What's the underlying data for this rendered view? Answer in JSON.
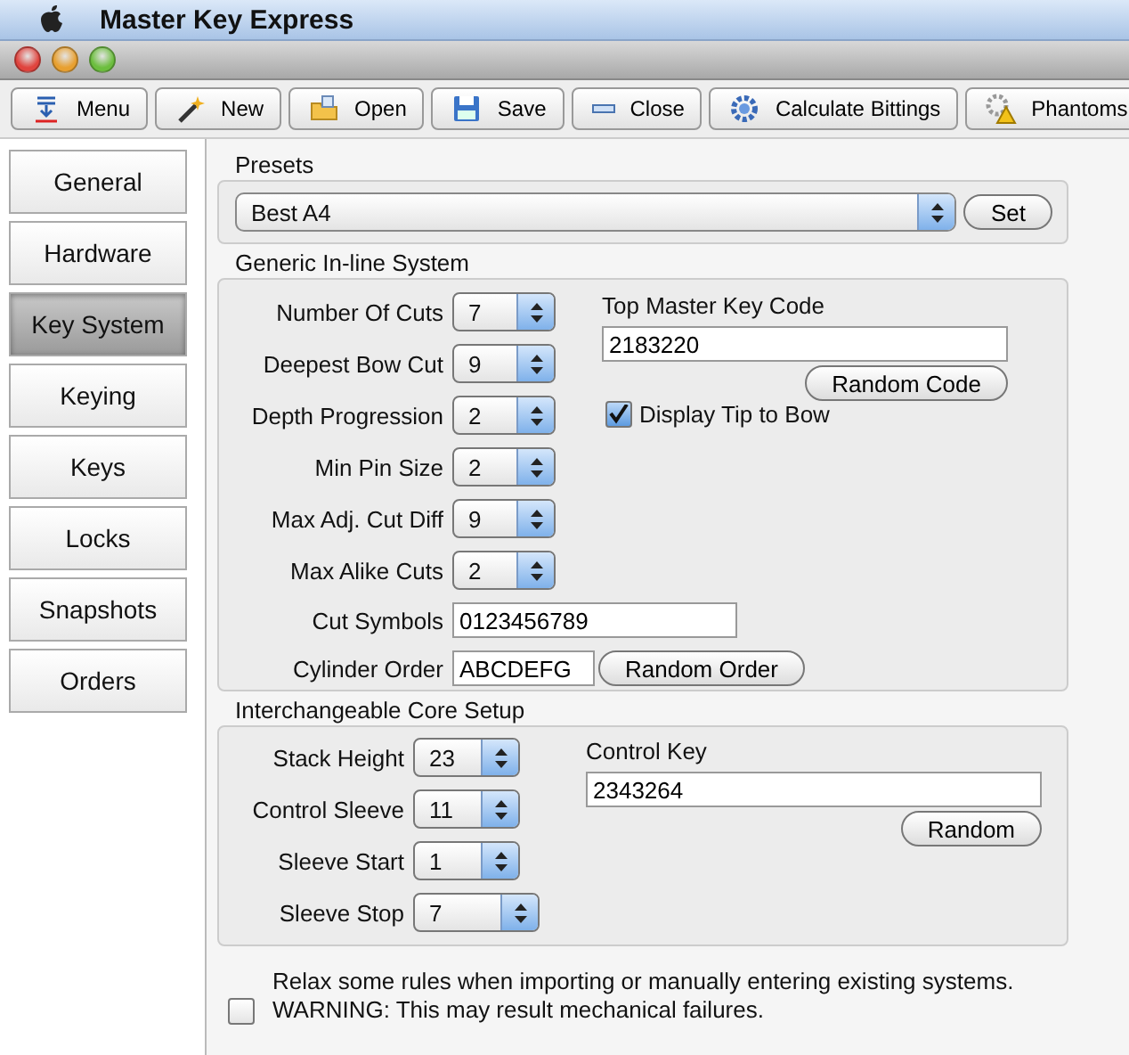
{
  "menu_bar": {
    "title": "Master Key Express"
  },
  "toolbar": [
    {
      "label": "Menu",
      "kind": "menu"
    },
    {
      "label": "New",
      "kind": "wand"
    },
    {
      "label": "Open",
      "kind": "folder"
    },
    {
      "label": "Save",
      "kind": "disk"
    },
    {
      "label": "Close",
      "kind": "minus"
    },
    {
      "label": "Calculate Bittings",
      "kind": "gear"
    },
    {
      "label": "Phantoms",
      "kind": "warning"
    }
  ],
  "sidebar": [
    {
      "label": "General",
      "selected": false
    },
    {
      "label": "Hardware",
      "selected": false
    },
    {
      "label": "Key System",
      "selected": true
    },
    {
      "label": "Keying",
      "selected": false
    },
    {
      "label": "Keys",
      "selected": false
    },
    {
      "label": "Locks",
      "selected": false
    },
    {
      "label": "Snapshots",
      "selected": false
    },
    {
      "label": "Orders",
      "selected": false
    }
  ],
  "presets": {
    "heading": "Presets",
    "value": "Best A4",
    "button": "Set"
  },
  "generic": {
    "heading": "Generic In-line System",
    "spinners": [
      {
        "label": "Number Of Cuts",
        "value": "7"
      },
      {
        "label": "Deepest Bow Cut",
        "value": "9"
      },
      {
        "label": "Depth Progression",
        "value": "2"
      },
      {
        "label": "Min Pin Size",
        "value": "2"
      },
      {
        "label": "Max Adj. Cut Diff",
        "value": "9"
      },
      {
        "label": "Max Alike Cuts",
        "value": "2"
      }
    ],
    "cut_symbols": {
      "label": "Cut Symbols",
      "value": "0123456789"
    },
    "cylinder_order": {
      "label": "Cylinder Order",
      "value": "ABCDEFG",
      "button": "Random Order"
    },
    "top_master": {
      "label": "Top Master Key Code",
      "value": "2183220",
      "button": "Random Code"
    },
    "tip_to_bow": {
      "label": "Display Tip to Bow",
      "checked": true
    }
  },
  "ics": {
    "heading": "Interchangeable Core Setup",
    "spinners": [
      {
        "label": "Stack Height",
        "value": "23"
      },
      {
        "label": "Control Sleeve",
        "value": "11"
      },
      {
        "label": "Sleeve Start",
        "value": "1"
      },
      {
        "label": "Sleeve Stop",
        "value": "7"
      }
    ],
    "control_key": {
      "label": "Control Key",
      "value": "2343264",
      "button": "Random"
    }
  },
  "relax": {
    "checked": false,
    "text": "Relax some rules when importing or manually entering existing systems.",
    "warning": "WARNING: This may result mechanical failures."
  }
}
